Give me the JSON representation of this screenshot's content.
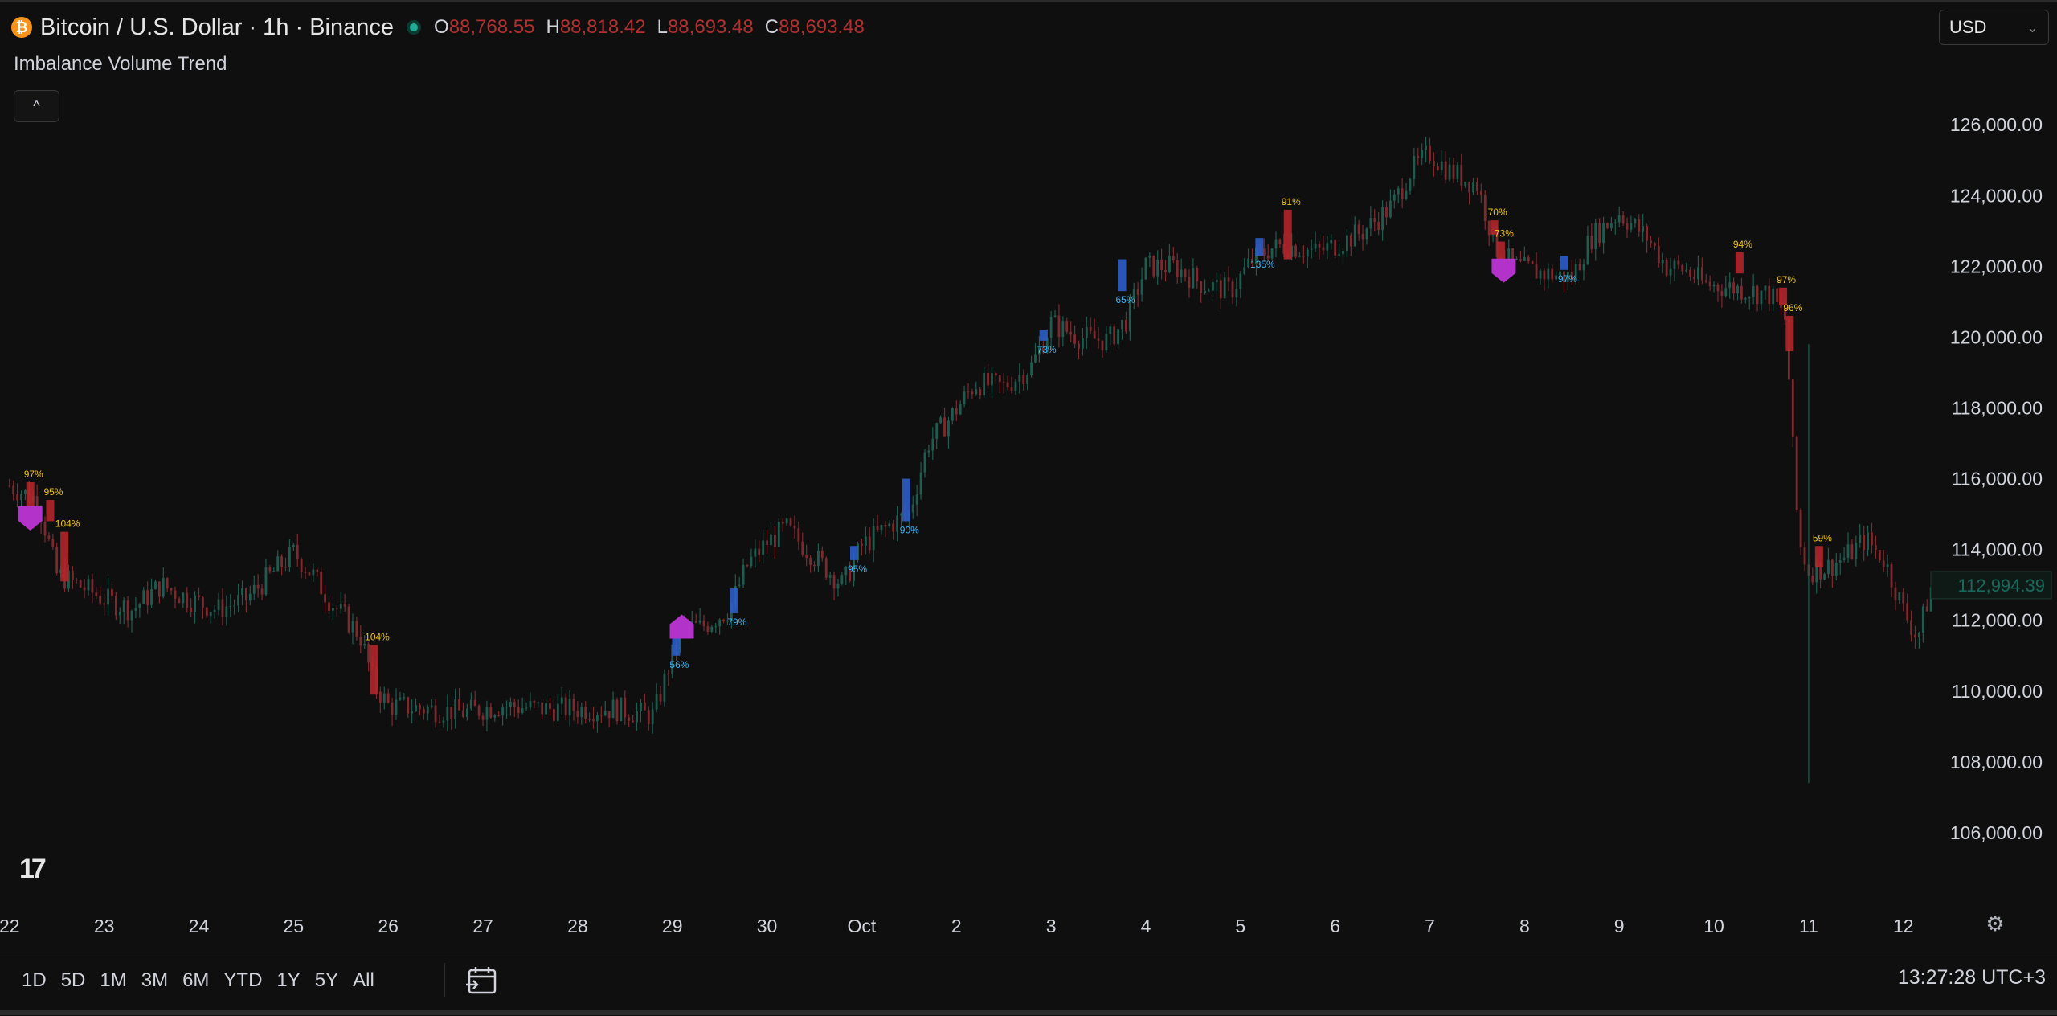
{
  "header": {
    "coin_glyph": "₿",
    "symbol": "Bitcoin / U.S. Dollar · 1h · Binance",
    "ohlc": [
      {
        "key": "O",
        "value": "88,768.55"
      },
      {
        "key": "H",
        "value": "88,818.42"
      },
      {
        "key": "L",
        "value": "88,693.48"
      },
      {
        "key": "C",
        "value": "88,693.48"
      }
    ],
    "currency": "USD",
    "currency_chevron": "⌄"
  },
  "indicator": {
    "name": "Imbalance Volume Trend",
    "collapse_glyph": "^"
  },
  "colors": {
    "background": "#0f0f0f",
    "up": "#1f5c4f",
    "down": "#7d2a2f",
    "bear_box": "#b3262a",
    "bull_box": "#2c5ec9",
    "signal": "#b332c9",
    "bear_text": "#f0c419",
    "bull_text": "#3fb5f0",
    "grid_text": "#d1d4dc",
    "last_price": "#22ab94"
  },
  "chart_data": {
    "type": "candlestick",
    "series_note": "BTCUSD 1h",
    "y_ticks": [
      "126,000.00",
      "124,000.00",
      "122,000.00",
      "120,000.00",
      "118,000.00",
      "116,000.00",
      "114,000.00",
      "112,000.00",
      "110,000.00",
      "108,000.00",
      "106,000.00"
    ],
    "y_tick_values": [
      126000,
      124000,
      122000,
      120000,
      118000,
      116000,
      114000,
      112000,
      110000,
      108000,
      106000
    ],
    "ylim": [
      105000,
      126800
    ],
    "x_ticks": [
      "22",
      "23",
      "24",
      "25",
      "26",
      "27",
      "28",
      "29",
      "30",
      "Oct",
      "2",
      "3",
      "4",
      "5",
      "6",
      "7",
      "8",
      "9",
      "10",
      "11",
      "12"
    ],
    "x_tick_days": [
      0,
      1,
      2,
      3,
      4,
      5,
      6,
      7,
      8,
      9,
      10,
      11,
      12,
      13,
      14,
      15,
      16,
      17,
      18,
      19,
      20
    ],
    "x_range_days": [
      -0.1,
      20.35
    ],
    "last_price_label": "112,994.39",
    "last_price": 112994.39,
    "price_path": [
      [
        0.0,
        115800
      ],
      [
        0.3,
        115400
      ],
      [
        0.5,
        113300
      ],
      [
        0.8,
        112900
      ],
      [
        1.0,
        112600
      ],
      [
        1.3,
        112300
      ],
      [
        1.6,
        113000
      ],
      [
        1.9,
        112600
      ],
      [
        2.2,
        112300
      ],
      [
        2.5,
        112600
      ],
      [
        2.8,
        113400
      ],
      [
        3.0,
        113900
      ],
      [
        3.2,
        113300
      ],
      [
        3.4,
        112500
      ],
      [
        3.7,
        111600
      ],
      [
        3.85,
        110200
      ],
      [
        4.0,
        109600
      ],
      [
        4.4,
        109500
      ],
      [
        4.8,
        109400
      ],
      [
        5.2,
        109600
      ],
      [
        5.6,
        109500
      ],
      [
        6.0,
        109500
      ],
      [
        6.4,
        109500
      ],
      [
        6.8,
        109300
      ],
      [
        7.0,
        111000
      ],
      [
        7.1,
        111800
      ],
      [
        7.3,
        111800
      ],
      [
        7.6,
        112300
      ],
      [
        7.8,
        113600
      ],
      [
        8.0,
        114200
      ],
      [
        8.2,
        114600
      ],
      [
        8.5,
        113800
      ],
      [
        8.8,
        113000
      ],
      [
        9.0,
        114100
      ],
      [
        9.3,
        114700
      ],
      [
        9.5,
        115000
      ],
      [
        9.7,
        117000
      ],
      [
        9.9,
        117600
      ],
      [
        10.2,
        118700
      ],
      [
        10.5,
        118600
      ],
      [
        10.8,
        119200
      ],
      [
        11.0,
        120400
      ],
      [
        11.3,
        120000
      ],
      [
        11.6,
        119900
      ],
      [
        11.8,
        120500
      ],
      [
        12.0,
        122000
      ],
      [
        12.3,
        122000
      ],
      [
        12.6,
        121500
      ],
      [
        12.9,
        121300
      ],
      [
        13.1,
        122100
      ],
      [
        13.3,
        122500
      ],
      [
        13.5,
        122600
      ],
      [
        13.8,
        122400
      ],
      [
        14.0,
        122600
      ],
      [
        14.3,
        123000
      ],
      [
        14.6,
        123700
      ],
      [
        14.8,
        124700
      ],
      [
        15.0,
        125200
      ],
      [
        15.2,
        124700
      ],
      [
        15.5,
        124300
      ],
      [
        15.7,
        122500
      ],
      [
        15.9,
        122000
      ],
      [
        16.2,
        121800
      ],
      [
        16.5,
        121700
      ],
      [
        16.7,
        122800
      ],
      [
        17.0,
        123500
      ],
      [
        17.3,
        122800
      ],
      [
        17.5,
        122000
      ],
      [
        17.7,
        121900
      ],
      [
        17.9,
        121500
      ],
      [
        18.2,
        121400
      ],
      [
        18.4,
        121300
      ],
      [
        18.6,
        121200
      ],
      [
        18.75,
        120500
      ],
      [
        18.8,
        118500
      ],
      [
        18.85,
        116000
      ],
      [
        18.9,
        114200
      ],
      [
        19.0,
        113400
      ],
      [
        19.2,
        113500
      ],
      [
        19.4,
        113800
      ],
      [
        19.6,
        114300
      ],
      [
        19.8,
        113700
      ],
      [
        20.0,
        112300
      ],
      [
        20.15,
        111500
      ],
      [
        20.3,
        112994
      ]
    ],
    "signals": [
      {
        "day": 0.22,
        "high": 115900,
        "low": 114600,
        "dir": "bear",
        "label": "97%"
      },
      {
        "day": 0.43,
        "high": 115400,
        "low": 114800,
        "dir": "bear",
        "label": "95%"
      },
      {
        "day": 0.58,
        "high": 114500,
        "low": 113100,
        "dir": "bear",
        "label": "104%"
      },
      {
        "day": 3.85,
        "high": 111300,
        "low": 109900,
        "dir": "bear",
        "label": "104%"
      },
      {
        "day": 7.04,
        "high": 111700,
        "low": 111000,
        "dir": "bull",
        "label": "56%"
      },
      {
        "day": 7.65,
        "high": 112900,
        "low": 112200,
        "dir": "bull",
        "label": "79%"
      },
      {
        "day": 8.92,
        "high": 114100,
        "low": 113700,
        "dir": "bull",
        "label": "95%"
      },
      {
        "day": 9.47,
        "high": 116000,
        "low": 114800,
        "dir": "bull",
        "label": "90%"
      },
      {
        "day": 10.92,
        "high": 120200,
        "low": 119900,
        "dir": "bull",
        "label": "73%"
      },
      {
        "day": 11.75,
        "high": 122200,
        "low": 121300,
        "dir": "bull",
        "label": "65%"
      },
      {
        "day": 13.2,
        "high": 122800,
        "low": 122300,
        "dir": "bull",
        "label": "135%"
      },
      {
        "day": 13.5,
        "high": 123600,
        "low": 122200,
        "dir": "bear",
        "label": "91%"
      },
      {
        "day": 15.68,
        "high": 123300,
        "low": 122900,
        "dir": "bear",
        "label": "70%"
      },
      {
        "day": 15.75,
        "high": 122700,
        "low": 122100,
        "dir": "bear",
        "label": "73%"
      },
      {
        "day": 16.42,
        "high": 122300,
        "low": 121900,
        "dir": "bull",
        "label": "97%"
      },
      {
        "day": 18.27,
        "high": 122400,
        "low": 121800,
        "dir": "bear",
        "label": "94%"
      },
      {
        "day": 18.73,
        "high": 121400,
        "low": 120900,
        "dir": "bear",
        "label": "97%"
      },
      {
        "day": 18.8,
        "high": 120600,
        "low": 119600,
        "dir": "bear",
        "label": "96%"
      },
      {
        "day": 19.11,
        "high": 114100,
        "low": 113500,
        "dir": "bear",
        "label": "59%"
      }
    ],
    "markers": [
      {
        "day": 0.22,
        "price": 114900,
        "dir": "down"
      },
      {
        "day": 7.1,
        "price": 111800,
        "dir": "up"
      },
      {
        "day": 15.78,
        "price": 121900,
        "dir": "down"
      }
    ]
  },
  "footer": {
    "logo": "17",
    "ranges": [
      "1D",
      "5D",
      "1M",
      "3M",
      "6M",
      "YTD",
      "1Y",
      "5Y",
      "All"
    ],
    "clock": "13:27:28 UTC+3",
    "settings_glyph": "⚙"
  }
}
